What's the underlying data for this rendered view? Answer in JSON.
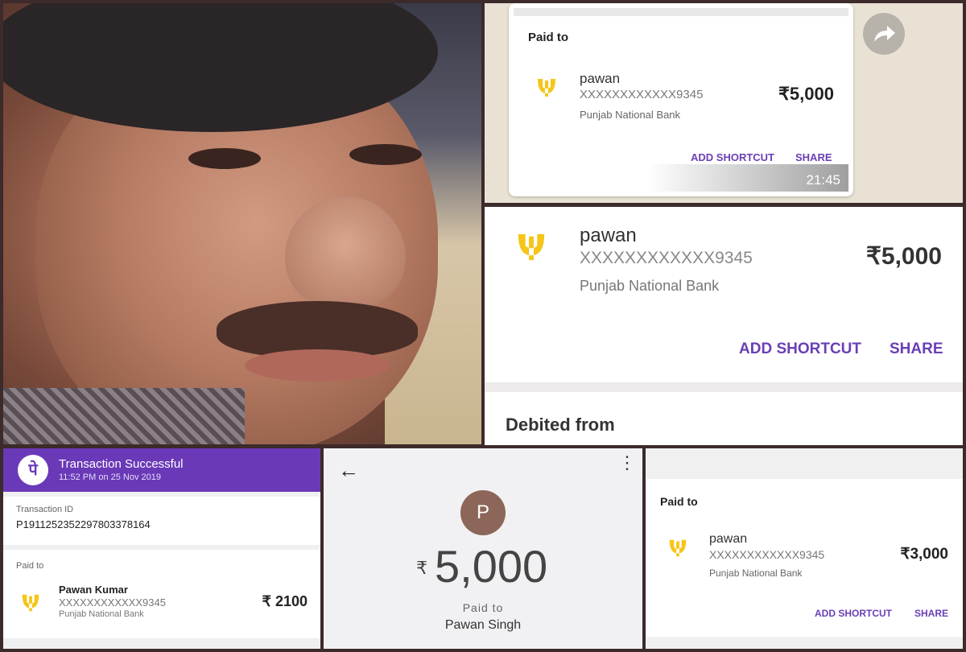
{
  "colors": {
    "accent": "#6a3fb5",
    "phonepe_header": "#6a39b8",
    "pnb_logo": "#f5c518"
  },
  "photo": {
    "description_icon": "person-photo"
  },
  "whatsapp_card": {
    "paid_to_label": "Paid to",
    "payee_name": "pawan",
    "account": "XXXXXXXXXXXX9345",
    "bank": "Punjab National Bank",
    "amount": "₹5,000",
    "add_shortcut": "ADD SHORTCUT",
    "share": "SHARE",
    "time": "21:45",
    "forward_icon": "forward-arrow-icon"
  },
  "zoom_card": {
    "payee_name": "pawan",
    "account": "XXXXXXXXXXXX9345",
    "bank": "Punjab National Bank",
    "amount": "₹5,000",
    "add_shortcut": "ADD SHORTCUT",
    "share": "SHARE",
    "debited_from": "Debited from"
  },
  "phonepe": {
    "app_icon_glyph": "पे",
    "title": "Transaction Successful",
    "subtitle": "11:52 PM on 25 Nov 2019",
    "transaction_id_label": "Transaction ID",
    "transaction_id": "P1911252352297803378164",
    "paid_to_label": "Paid to",
    "payee_name": "Pawan Kumar",
    "account": "XXXXXXXXXXXX9345",
    "bank": "Punjab National Bank",
    "amount": "₹ 2100"
  },
  "gpay": {
    "back_icon": "←",
    "menu_icon": "⋮",
    "avatar_letter": "P",
    "currency": "₹",
    "amount": "5,000",
    "paid_to_label": "Paid to",
    "payee_name": "Pawan Singh"
  },
  "bottom_right_card": {
    "paid_to_label": "Paid to",
    "payee_name": "pawan",
    "account": "XXXXXXXXXXXX9345",
    "bank": "Punjab National Bank",
    "amount": "₹3,000",
    "add_shortcut": "ADD SHORTCUT",
    "share": "SHARE"
  }
}
